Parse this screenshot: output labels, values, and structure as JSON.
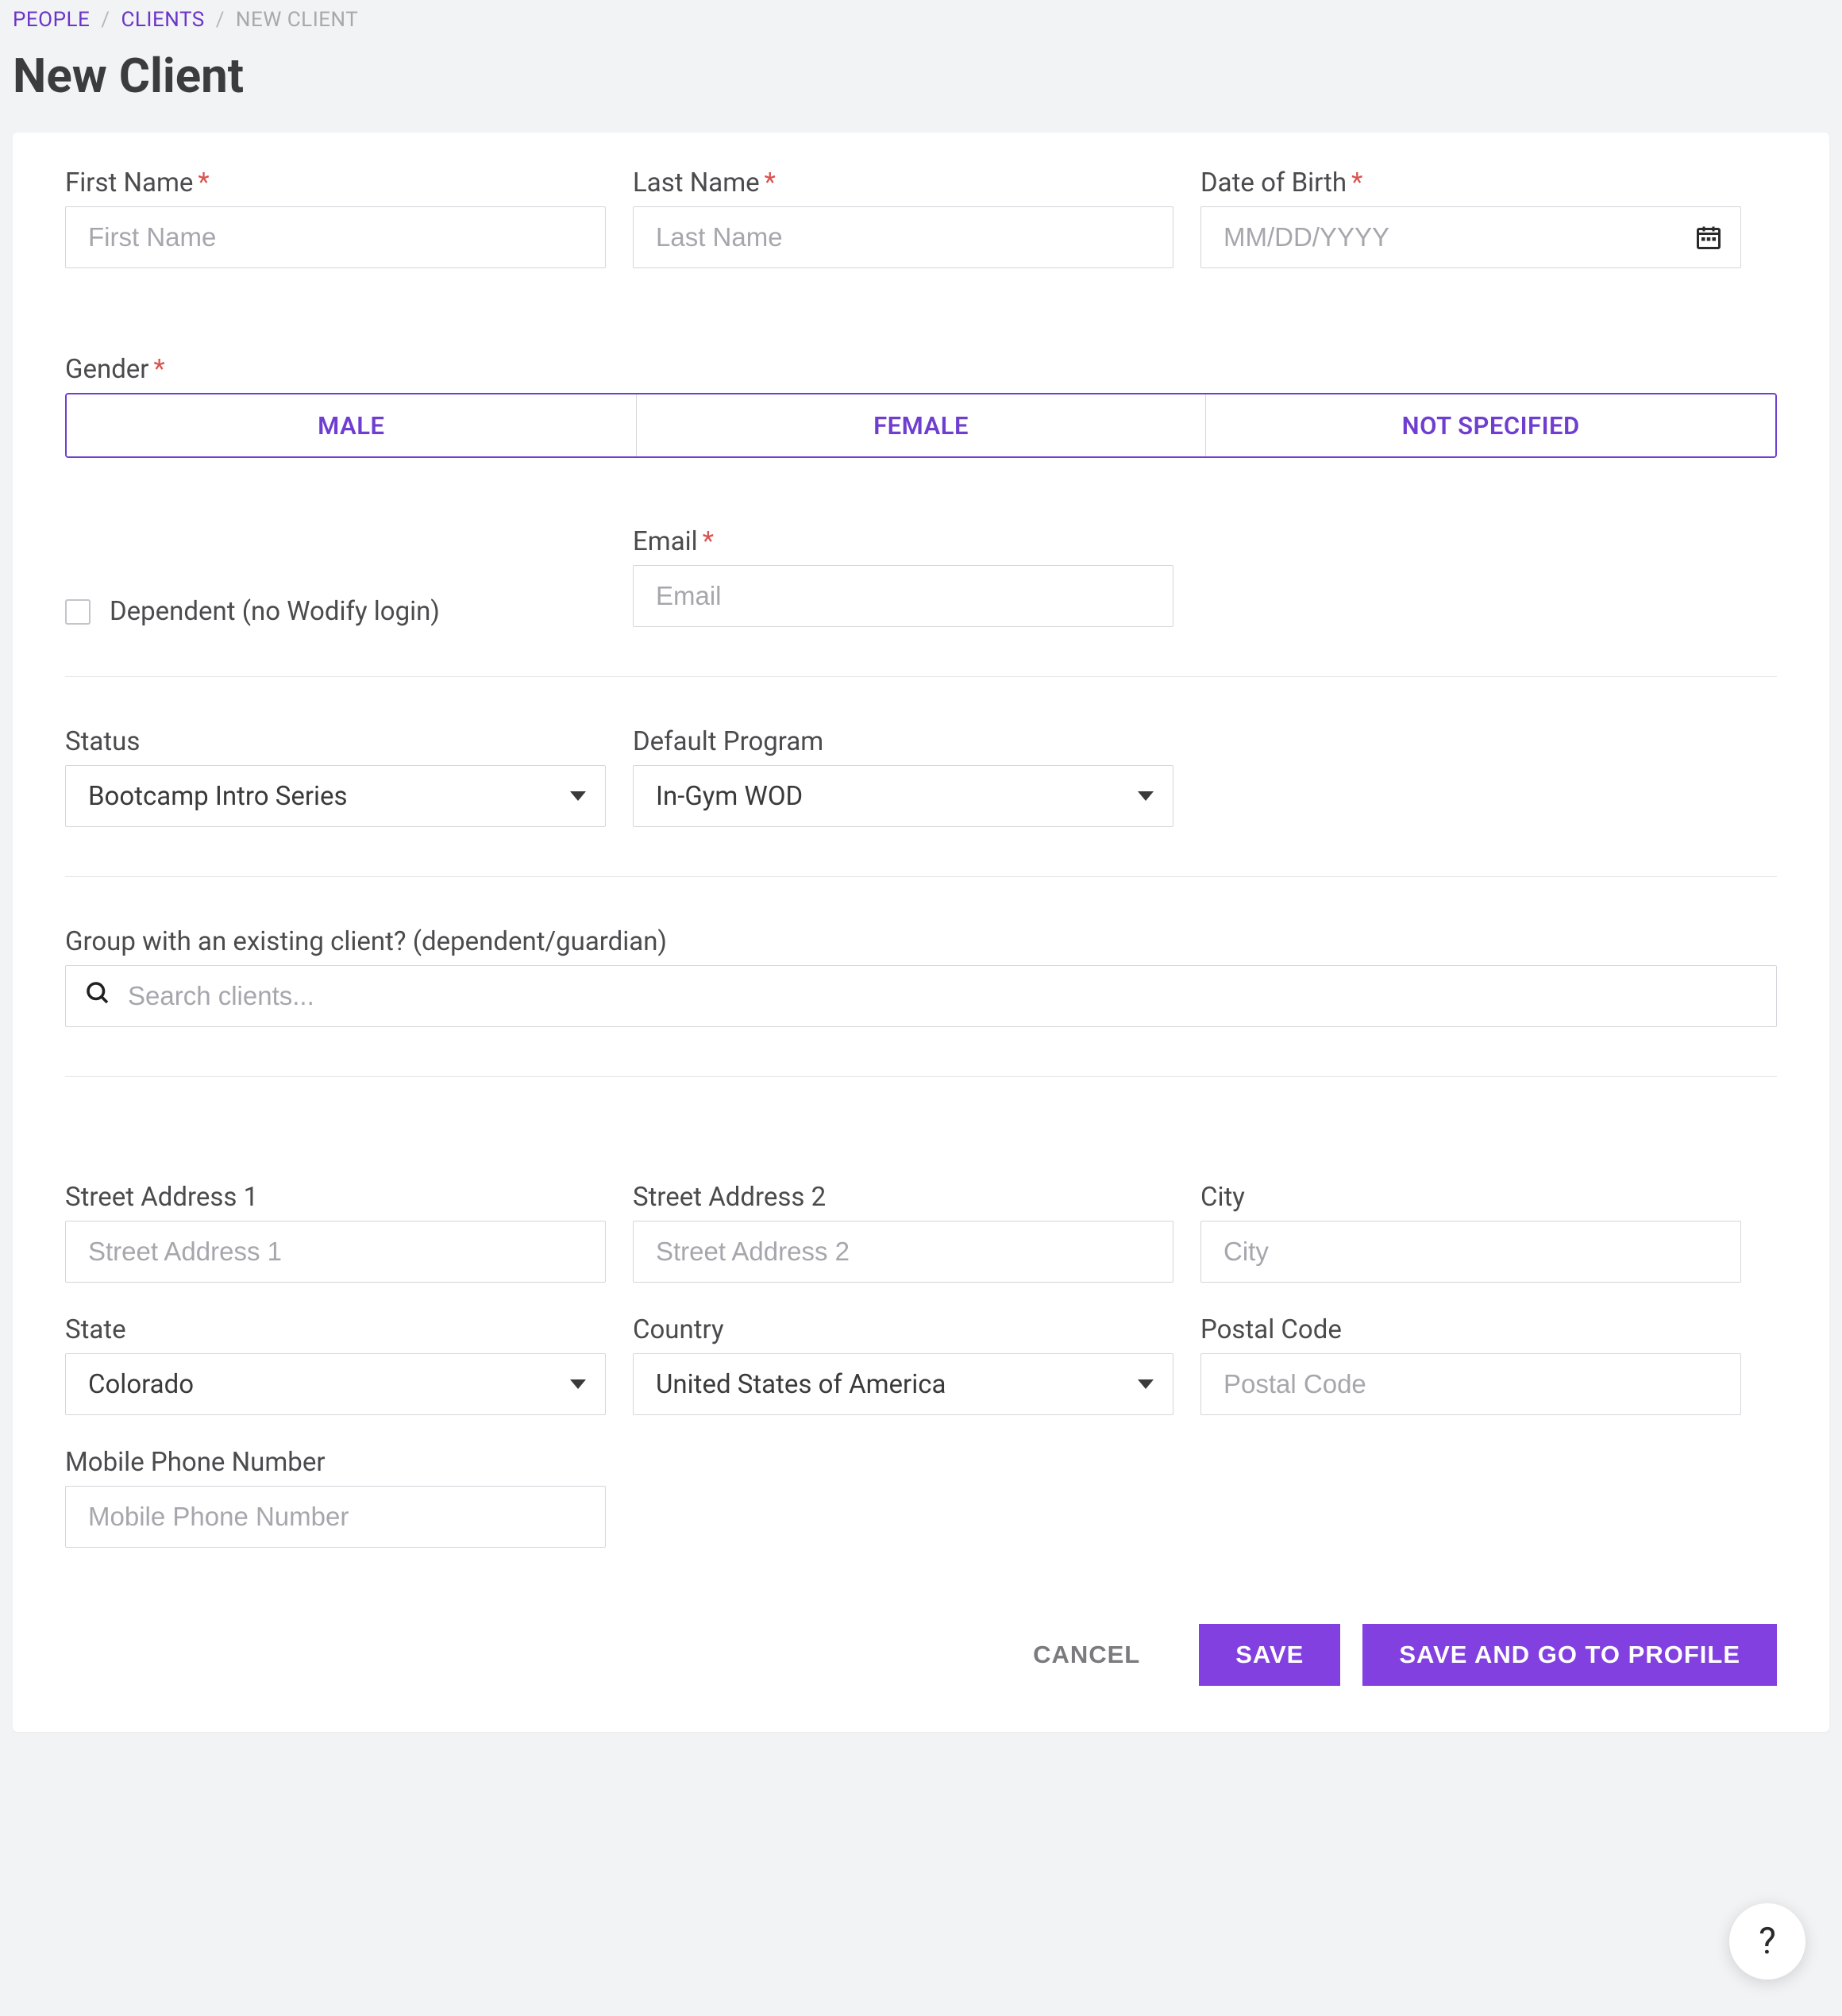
{
  "breadcrumb": {
    "people": "PEOPLE",
    "clients": "CLIENTS",
    "current": "NEW CLIENT"
  },
  "page_title": "New Client",
  "labels": {
    "first_name": "First Name",
    "last_name": "Last Name",
    "dob": "Date of Birth",
    "gender": "Gender",
    "email": "Email",
    "status": "Status",
    "default_program": "Default Program",
    "group_with": "Group with an existing client? (dependent/guardian)",
    "street1": "Street Address 1",
    "street2": "Street Address 2",
    "city": "City",
    "state": "State",
    "country": "Country",
    "postal": "Postal Code",
    "mobile": "Mobile Phone Number"
  },
  "placeholders": {
    "first_name": "First Name",
    "last_name": "Last Name",
    "dob": "MM/DD/YYYY",
    "email": "Email",
    "search_clients": "Search clients...",
    "street1": "Street Address 1",
    "street2": "Street Address 2",
    "city": "City",
    "postal": "Postal Code",
    "mobile": "Mobile Phone Number"
  },
  "gender_options": {
    "male": "MALE",
    "female": "FEMALE",
    "not_specified": "NOT SPECIFIED"
  },
  "checkbox": {
    "dependent": "Dependent (no Wodify login)"
  },
  "selects": {
    "status": "Bootcamp Intro Series",
    "default_program": "In-Gym WOD",
    "state": "Colorado",
    "country": "United States of America"
  },
  "actions": {
    "cancel": "CANCEL",
    "save": "SAVE",
    "save_profile": "SAVE AND GO TO PROFILE"
  },
  "help": "?"
}
